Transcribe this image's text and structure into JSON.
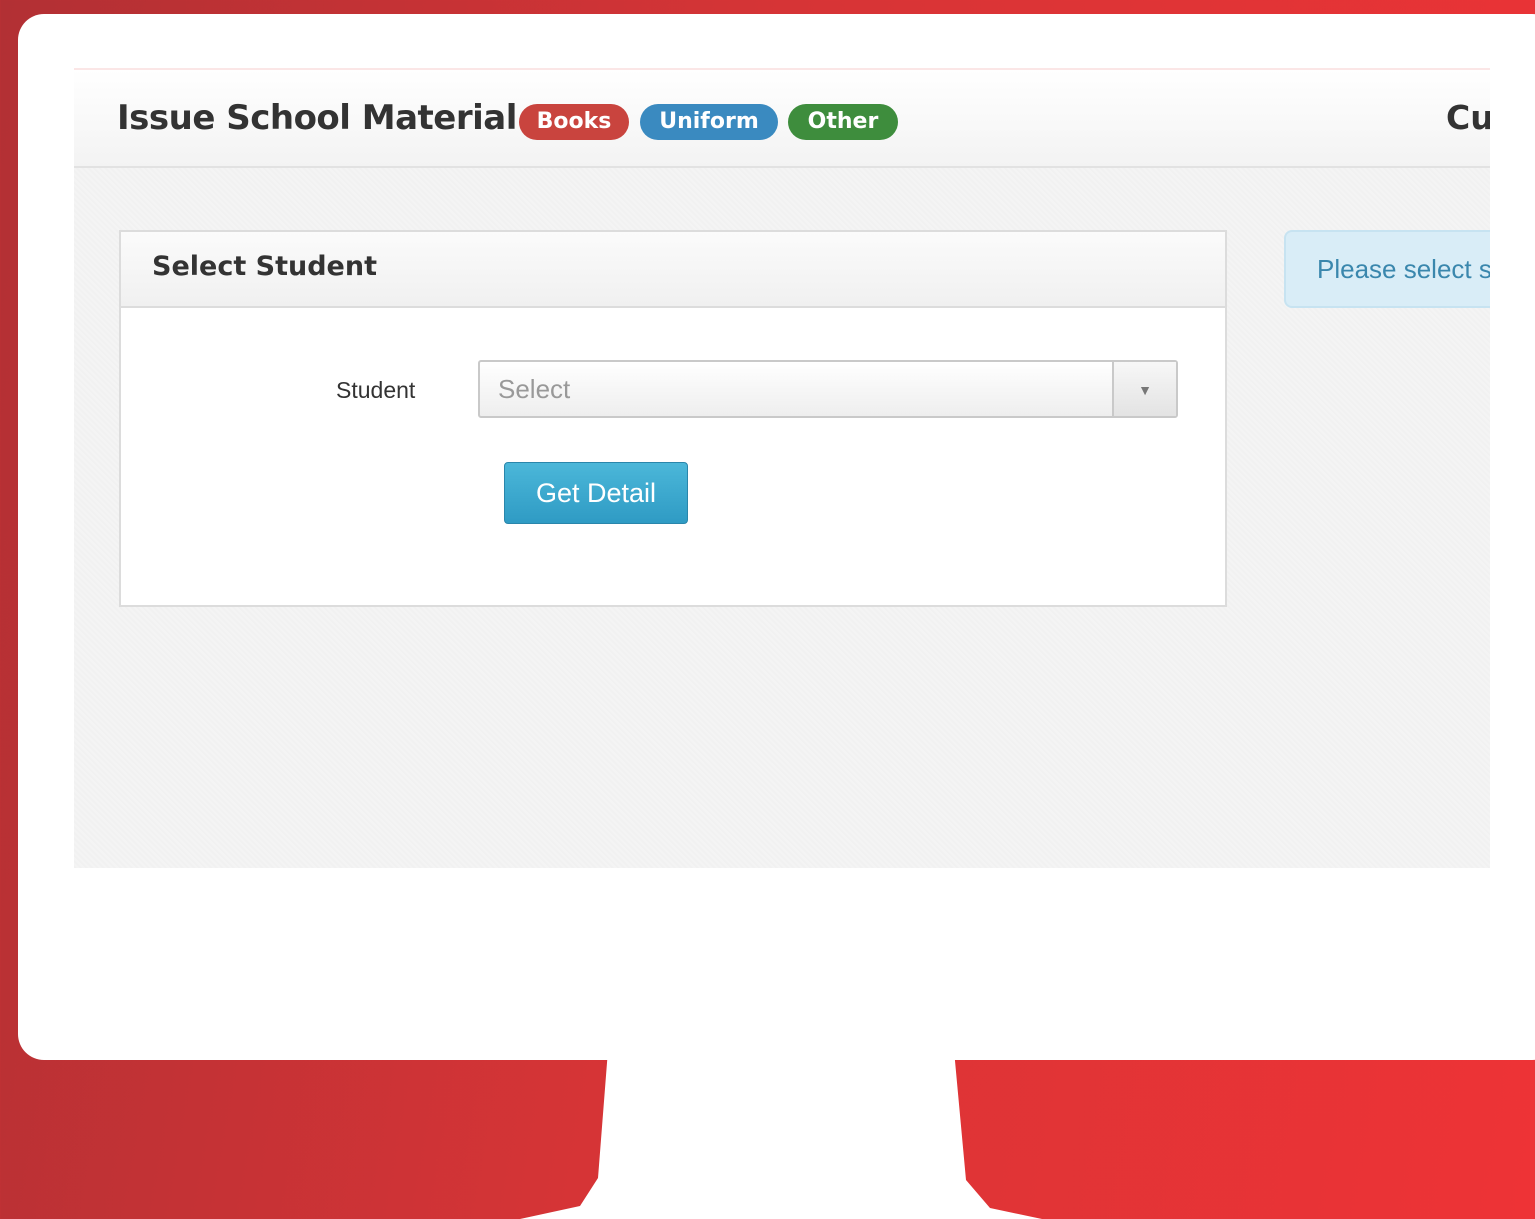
{
  "header": {
    "title": "Issue School Material",
    "badges": [
      "Books",
      "Uniform",
      "Other"
    ],
    "right_text": "Cu"
  },
  "panel": {
    "title": "Select Student",
    "student_label": "Student",
    "student_select_value": "Select",
    "submit_label": "Get Detail"
  },
  "info_alert": {
    "text": "Please select s"
  },
  "colors": {
    "books_badge": "#c9443e",
    "uniform_badge": "#3a8ac0",
    "other_badge": "#3e8d3d",
    "primary_button": "#3aa8d0",
    "background": "#d63436"
  }
}
